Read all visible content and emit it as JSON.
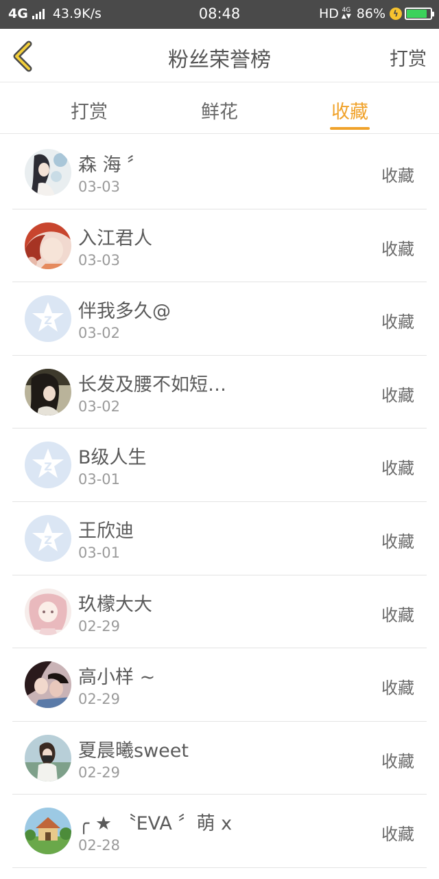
{
  "status_bar": {
    "network": "4G",
    "speed": "43.9K/s",
    "time": "08:48",
    "hd": "HD",
    "net_type": "4G",
    "battery": "86%"
  },
  "header": {
    "title": "粉丝荣誉榜",
    "right_action": "打赏"
  },
  "tabs": [
    {
      "label": "打赏",
      "active": false
    },
    {
      "label": "鲜花",
      "active": false
    },
    {
      "label": "收藏",
      "active": true
    }
  ],
  "colors": {
    "accent": "#f0a22a",
    "status_bar_bg": "#4a4a4a",
    "battery_green": "#3bd25b",
    "default_avatar": "#dbe6f4"
  },
  "fans": [
    {
      "name": "森 海 〞",
      "date": "03-03",
      "action": "收藏",
      "avatar": "anime-girl-avatar"
    },
    {
      "name": "入江君人",
      "date": "03-03",
      "action": "收藏",
      "avatar": "anime-boy-avatar"
    },
    {
      "name": "伴我多久@",
      "date": "03-02",
      "action": "收藏",
      "avatar": "default-qq-avatar"
    },
    {
      "name": "长发及腰不如短…",
      "date": "03-02",
      "action": "收藏",
      "avatar": "photo-girl-avatar"
    },
    {
      "name": "B级人生",
      "date": "03-01",
      "action": "收藏",
      "avatar": "default-qq-avatar"
    },
    {
      "name": "王欣迪",
      "date": "03-01",
      "action": "收藏",
      "avatar": "default-qq-avatar"
    },
    {
      "name": "玖檬大大",
      "date": "02-29",
      "action": "收藏",
      "avatar": "pink-anime-avatar"
    },
    {
      "name": "高小样 ~",
      "date": "02-29",
      "action": "收藏",
      "avatar": "photo-couple-avatar"
    },
    {
      "name": "夏晨曦sweet",
      "date": "02-29",
      "action": "收藏",
      "avatar": "photo-camera-girl-avatar"
    },
    {
      "name": "╭ ★ 〝EVA 〞萌 x",
      "date": "02-28",
      "action": "收藏",
      "avatar": "landscape-house-avatar"
    }
  ]
}
